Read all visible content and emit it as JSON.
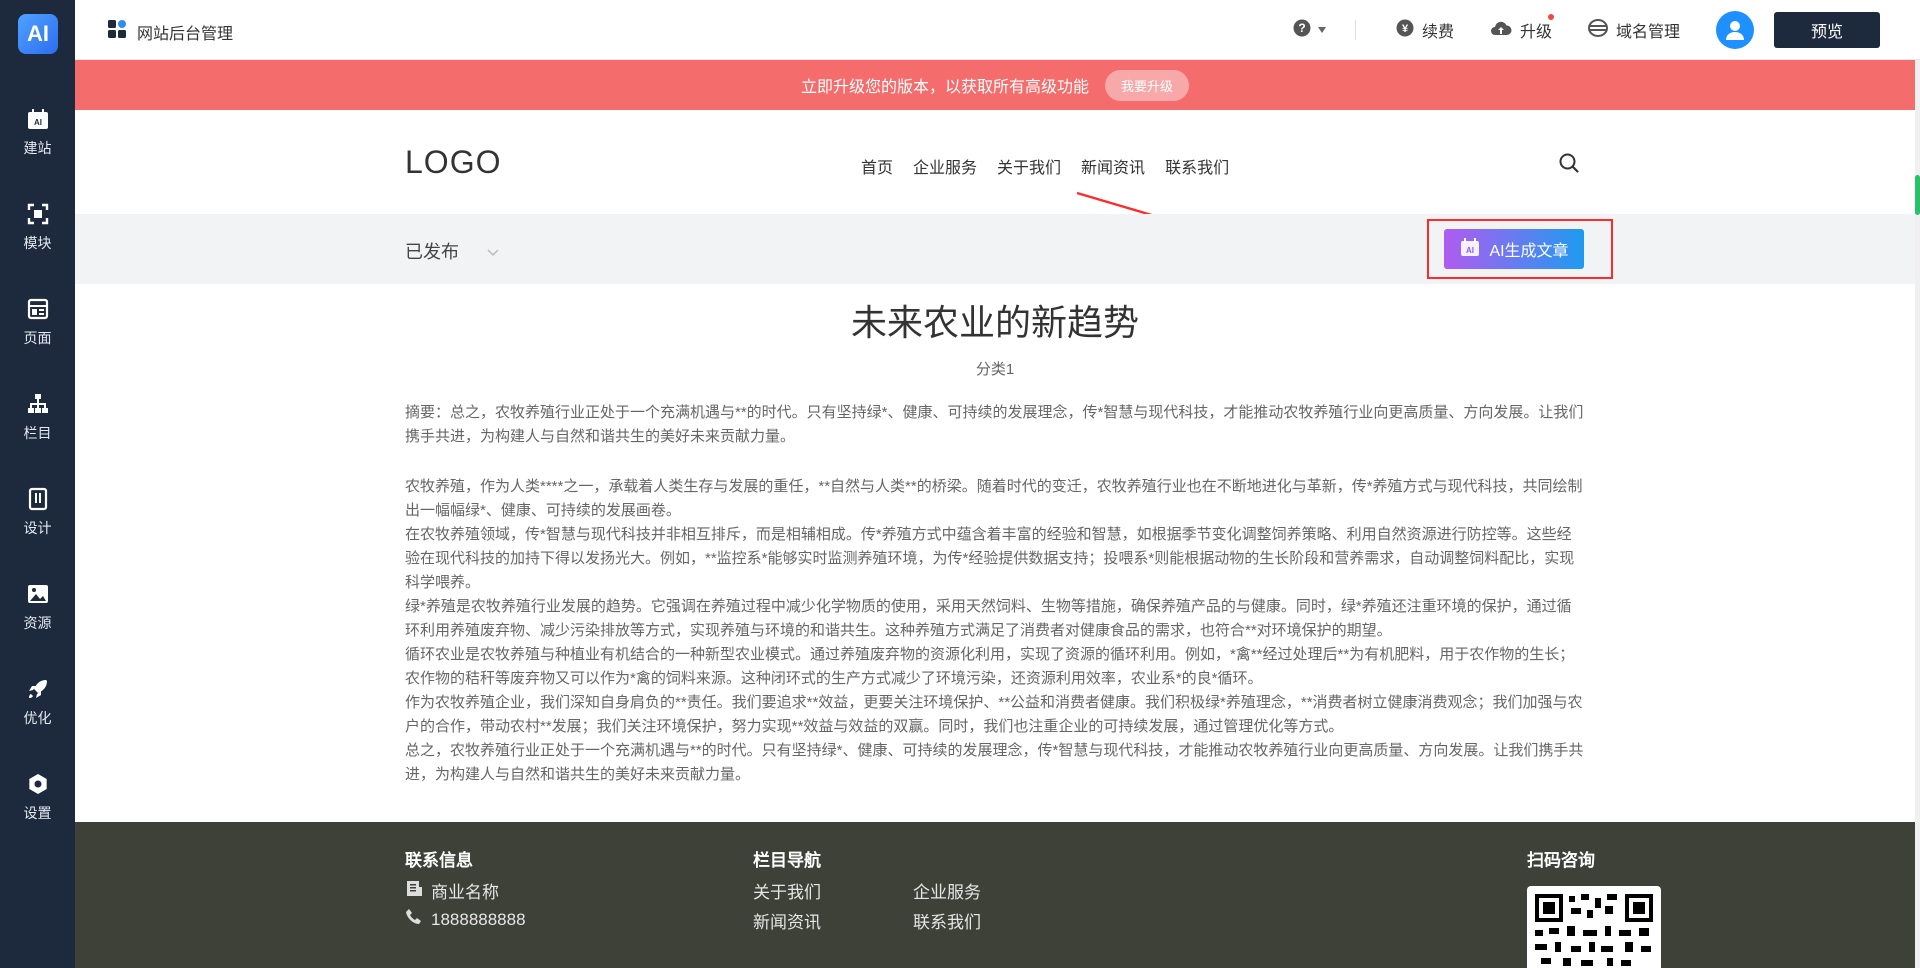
{
  "sidebar": {
    "logo": "AI",
    "items": [
      {
        "label": "建站",
        "icon": "ai-site-icon"
      },
      {
        "label": "模块",
        "icon": "module-icon"
      },
      {
        "label": "页面",
        "icon": "page-icon"
      },
      {
        "label": "栏目",
        "icon": "sitemap-icon"
      },
      {
        "label": "设计",
        "icon": "design-icon"
      },
      {
        "label": "资源",
        "icon": "image-icon"
      },
      {
        "label": "优化",
        "icon": "rocket-icon"
      },
      {
        "label": "设置",
        "icon": "gear-icon"
      }
    ]
  },
  "topbar": {
    "brand": "网站后台管理",
    "renew": "续费",
    "upgrade": "升级",
    "domain": "域名管理",
    "preview": "预览"
  },
  "promo": {
    "text": "立即升级您的版本，以获取所有高级功能",
    "button": "我要升级"
  },
  "site": {
    "logo": "LOGO",
    "nav": [
      "首页",
      "企业服务",
      "关于我们",
      "新闻资讯",
      "联系我们"
    ]
  },
  "status": {
    "selected": "已发布",
    "ai_button": "AI生成文章"
  },
  "article": {
    "title": "未来农业的新趋势",
    "category": "分类1",
    "summary": "摘要：总之，农牧养殖行业正处于一个充满机遇与**的时代。只有坚持绿*、健康、可持续的发展理念，传*智慧与现代科技，才能推动农牧养殖行业向更高质量、方向发展。让我们携手共进，为构建人与自然和谐共生的美好未来贡献力量。",
    "paragraphs": [
      "农牧养殖，作为人类****之一，承载着人类生存与发展的重任，**自然与人类**的桥梁。随着时代的变迁，农牧养殖行业也在不断地进化与革新，传*养殖方式与现代科技，共同绘制出一幅幅绿*、健康、可持续的发展画卷。",
      "在农牧养殖领域，传*智慧与现代科技并非相互排斥，而是相辅相成。传*养殖方式中蕴含着丰富的经验和智慧，如根据季节变化调整饲养策略、利用自然资源进行防控等。这些经验在现代科技的加持下得以发扬光大。例如，**监控系*能够实时监测养殖环境，为传*经验提供数据支持；投喂系*则能根据动物的生长阶段和营养需求，自动调整饲料配比，实现科学喂养。",
      "绿*养殖是农牧养殖行业发展的趋势。它强调在养殖过程中减少化学物质的使用，采用天然饲料、生物等措施，确保养殖产品的与健康。同时，绿*养殖还注重环境的保护，通过循环利用养殖废弃物、减少污染排放等方式，实现养殖与环境的和谐共生。这种养殖方式满足了消费者对健康食品的需求，也符合**对环境保护的期望。",
      "循环农业是农牧养殖与种植业有机结合的一种新型农业模式。通过养殖废弃物的资源化利用，实现了资源的循环利用。例如，*禽**经过处理后**为有机肥料，用于农作物的生长；农作物的秸秆等废弃物又可以作为*禽的饲料来源。这种闭环式的生产方式减少了环境污染，还资源利用效率，农业系*的良*循环。",
      "作为农牧养殖企业，我们深知自身肩负的**责任。我们要追求**效益，更要关注环境保护、**公益和消费者健康。我们积极绿*养殖理念，**消费者树立健康消费观念；我们加强与农户的合作，带动农村**发展；我们关注环境保护，努力实现**效益与效益的双赢。同时，我们也注重企业的可持续发展，通过管理优化等方式。",
      "总之，农牧养殖行业正处于一个充满机遇与**的时代。只有坚持绿*、健康、可持续的发展理念，传*智慧与现代科技，才能推动农牧养殖行业向更高质量、方向发展。让我们携手共进，为构建人与自然和谐共生的美好未来贡献力量。"
    ]
  },
  "footer": {
    "contact_title": "联系信息",
    "company": "商业名称",
    "phone": "1888888888",
    "nav_title": "栏目导航",
    "nav": [
      "关于我们",
      "企业服务",
      "新闻资讯",
      "联系我们"
    ],
    "qr_title": "扫码咨询"
  },
  "colors": {
    "sidebar_bg": "#1d2a3e",
    "promo_bg": "#f56c6c",
    "footer_bg": "#3e4138",
    "highlight": "#ff2b2b"
  }
}
